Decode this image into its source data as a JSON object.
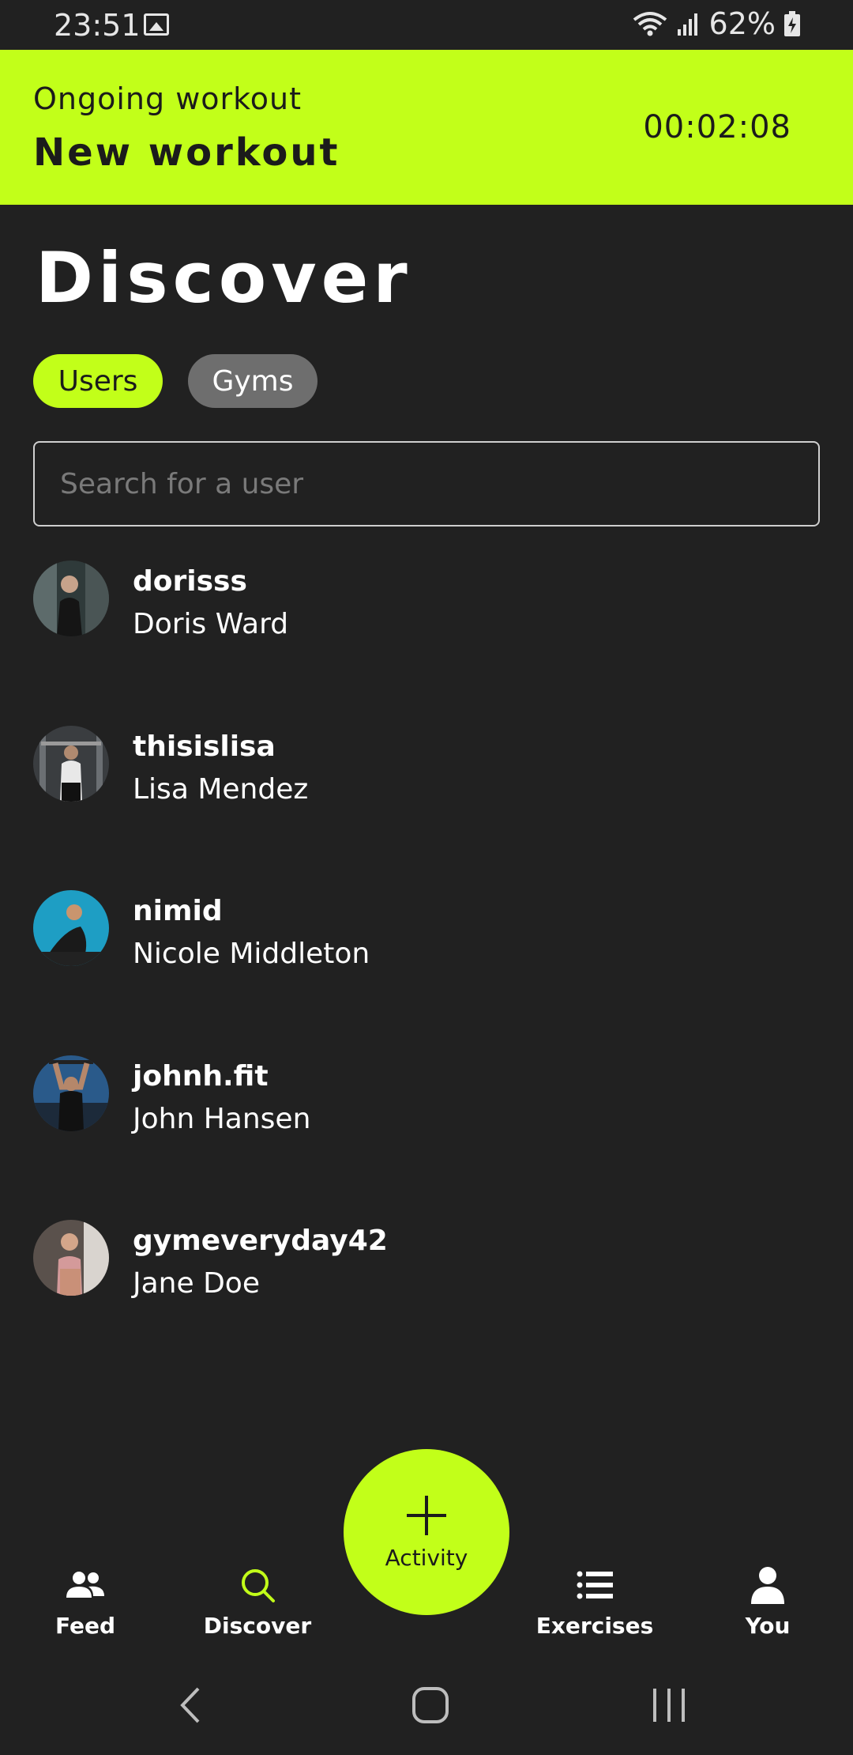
{
  "status_bar": {
    "time": "23:51",
    "battery": "62%"
  },
  "workout_banner": {
    "subtitle": "Ongoing workout",
    "title": "New workout",
    "timer": "00:02:08"
  },
  "page": {
    "title": "Discover"
  },
  "tabs": [
    {
      "label": "Users",
      "active": true
    },
    {
      "label": "Gyms",
      "active": false
    }
  ],
  "search": {
    "placeholder": "Search for a user",
    "value": ""
  },
  "users": [
    {
      "handle": "dorisss",
      "name": "Doris Ward"
    },
    {
      "handle": "thisislisa",
      "name": "Lisa Mendez"
    },
    {
      "handle": "nimid",
      "name": "Nicole Middleton"
    },
    {
      "handle": "johnh.fit",
      "name": "John Hansen"
    },
    {
      "handle": "gymeveryday42",
      "name": "Jane Doe"
    }
  ],
  "bottom_nav": {
    "feed": "Feed",
    "discover": "Discover",
    "activity": "Activity",
    "exercises": "Exercises",
    "you": "You"
  },
  "colors": {
    "accent": "#c2ff19",
    "background": "#212121",
    "inactive_tab": "#6e6e6e"
  }
}
